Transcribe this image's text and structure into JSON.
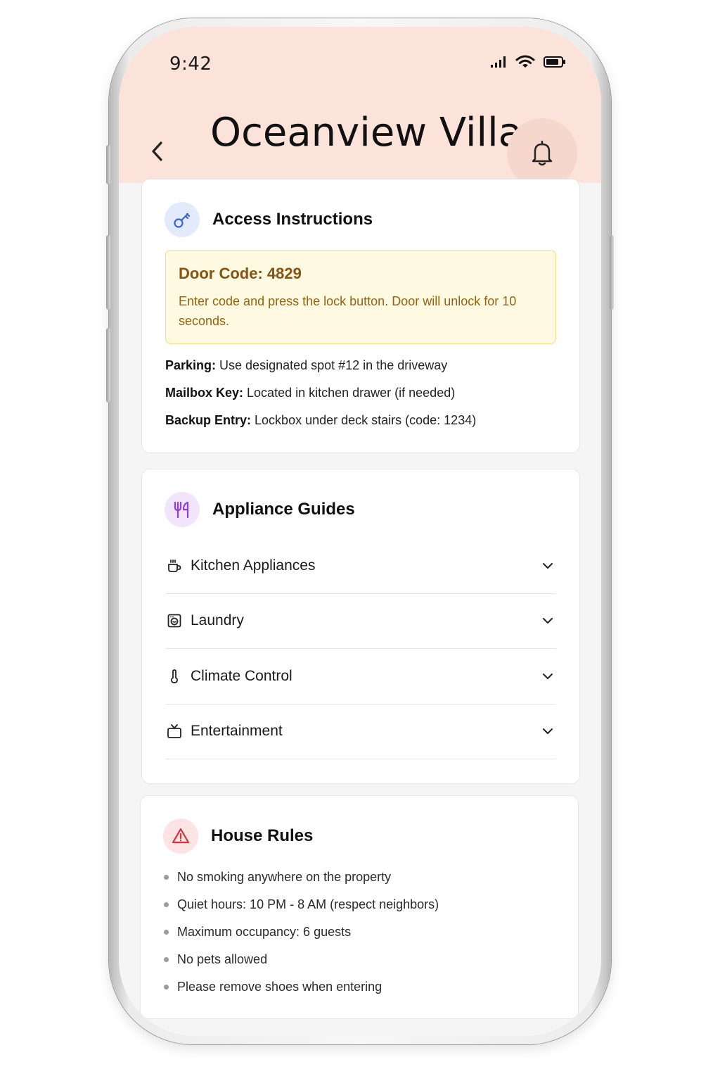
{
  "status_bar": {
    "time": "9:42",
    "icons": [
      "signal-icon",
      "wifi-icon",
      "battery-icon"
    ]
  },
  "header": {
    "title": "Oceanview Villa",
    "back_icon": "chevron-left-icon",
    "notification_icon": "bell-icon",
    "background_color": "#fbe3da"
  },
  "access": {
    "title": "Access Instructions",
    "icon": "key-icon",
    "door_code_label": "Door Code: 4829",
    "door_code_desc": "Enter code and press the lock button. Door will unlock for 10 seconds.",
    "items": [
      {
        "label": "Parking:",
        "text": " Use designated spot #12 in the driveway"
      },
      {
        "label": "Mailbox Key:",
        "text": " Located in kitchen drawer (if needed)"
      },
      {
        "label": "Backup Entry:",
        "text": " Lockbox under deck stairs (code: 1234)"
      }
    ]
  },
  "appliances": {
    "title": "Appliance Guides",
    "icon": "utensils-icon",
    "items": [
      {
        "label": "Kitchen Appliances",
        "icon": "coffee-cup-icon"
      },
      {
        "label": "Laundry",
        "icon": "washing-machine-icon"
      },
      {
        "label": "Climate Control",
        "icon": "thermometer-icon"
      },
      {
        "label": "Entertainment",
        "icon": "tv-icon"
      }
    ]
  },
  "rules": {
    "title": "House Rules",
    "icon": "warning-triangle-icon",
    "items": [
      "No smoking anywhere on the property",
      "Quiet hours: 10 PM - 8 AM (respect neighbors)",
      "Maximum occupancy: 6 guests",
      "No pets allowed",
      "Please remove shoes when entering"
    ]
  },
  "colors": {
    "key_accent": "#3b63d6",
    "utensils_accent": "#8b3fd6",
    "warning_accent": "#d6333a",
    "door_box_bg": "#fef9e1",
    "door_box_text": "#865312"
  }
}
